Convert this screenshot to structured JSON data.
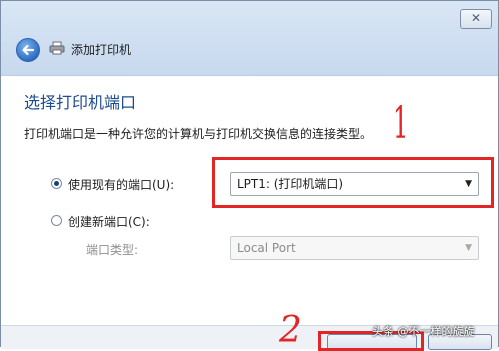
{
  "window": {
    "close_glyph": "✕",
    "title": "添加打印机"
  },
  "page": {
    "heading": "选择打印机端口",
    "description": "打印机端口是一种允许您的计算机与打印机交换信息的连接类型。"
  },
  "options": {
    "existing": {
      "label": "使用现有的端口(U):",
      "checked": true,
      "value": "LPT1: (打印机端口)"
    },
    "create": {
      "label": "创建新端口(C):",
      "checked": false
    },
    "port_type": {
      "label": "端口类型:",
      "value": "Local Port"
    }
  },
  "annotations": {
    "mark1": "1",
    "mark2": "2"
  },
  "watermark": "头条 @不一样的旋旋",
  "icons": {
    "back": "back-arrow-icon",
    "printer": "printer-icon",
    "dropdown": "chevron-down-icon"
  },
  "colors": {
    "annotation_red": "#e32525",
    "heading_blue": "#1c4c8c"
  }
}
